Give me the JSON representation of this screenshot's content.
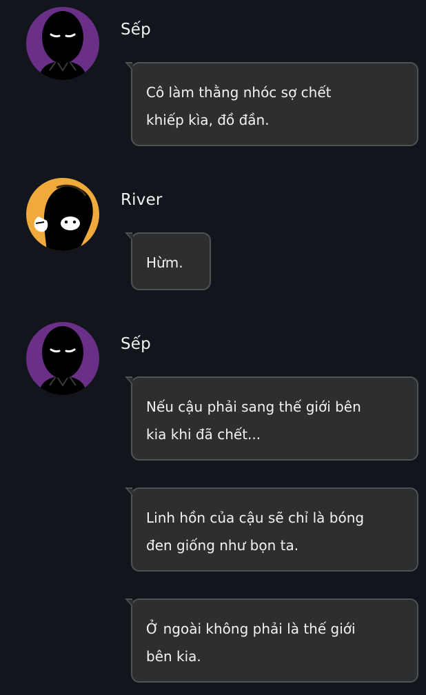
{
  "chat": {
    "messages": [
      {
        "sender": "Sếp",
        "avatar_icon": "shadow-boss-avatar",
        "bubbles": [
          {
            "lines": [
              "Cô làm thằng nhóc sợ chết",
              "khiếp kìa, đồ đần."
            ]
          }
        ]
      },
      {
        "sender": "River",
        "avatar_icon": "river-avatar",
        "bubbles": [
          {
            "lines": [
              "Hừm."
            ]
          }
        ]
      },
      {
        "sender": "Sếp",
        "avatar_icon": "shadow-boss-avatar",
        "bubbles": [
          {
            "lines": [
              "Nếu cậu phải sang thế giới bên",
              "kia khi đã chết..."
            ]
          },
          {
            "lines": [
              "Linh hồn của cậu sẽ chỉ là bóng",
              "đen giống như bọn ta."
            ]
          },
          {
            "lines": [
              "Ở ngoài không phải là thế giới",
              "bên kia."
            ]
          }
        ]
      }
    ]
  },
  "colors": {
    "background": "#12151c",
    "bubble_fill": "#2d2e30",
    "bubble_border": "#505254",
    "boss_avatar_bg": "#6a2f86",
    "river_avatar_bg": "#f0a93b",
    "text": "#f3f3f3"
  }
}
